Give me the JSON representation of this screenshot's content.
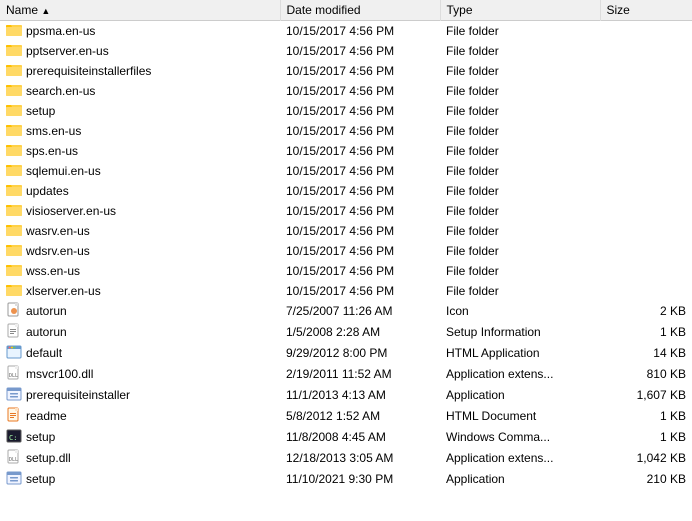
{
  "columns": [
    {
      "label": "Name",
      "key": "name",
      "sort": true
    },
    {
      "label": "Date modified",
      "key": "date"
    },
    {
      "label": "Type",
      "key": "type"
    },
    {
      "label": "Size",
      "key": "size"
    }
  ],
  "rows": [
    {
      "name": "ppsma.en-us",
      "date": "10/15/2017 4:56 PM",
      "type": "File folder",
      "size": "",
      "icon": "folder"
    },
    {
      "name": "pptserver.en-us",
      "date": "10/15/2017 4:56 PM",
      "type": "File folder",
      "size": "",
      "icon": "folder"
    },
    {
      "name": "prerequisiteinstallerfiles",
      "date": "10/15/2017 4:56 PM",
      "type": "File folder",
      "size": "",
      "icon": "folder"
    },
    {
      "name": "search.en-us",
      "date": "10/15/2017 4:56 PM",
      "type": "File folder",
      "size": "",
      "icon": "folder"
    },
    {
      "name": "setup",
      "date": "10/15/2017 4:56 PM",
      "type": "File folder",
      "size": "",
      "icon": "folder"
    },
    {
      "name": "sms.en-us",
      "date": "10/15/2017 4:56 PM",
      "type": "File folder",
      "size": "",
      "icon": "folder"
    },
    {
      "name": "sps.en-us",
      "date": "10/15/2017 4:56 PM",
      "type": "File folder",
      "size": "",
      "icon": "folder"
    },
    {
      "name": "sqlemui.en-us",
      "date": "10/15/2017 4:56 PM",
      "type": "File folder",
      "size": "",
      "icon": "folder"
    },
    {
      "name": "updates",
      "date": "10/15/2017 4:56 PM",
      "type": "File folder",
      "size": "",
      "icon": "folder"
    },
    {
      "name": "visioserver.en-us",
      "date": "10/15/2017 4:56 PM",
      "type": "File folder",
      "size": "",
      "icon": "folder"
    },
    {
      "name": "wasrv.en-us",
      "date": "10/15/2017 4:56 PM",
      "type": "File folder",
      "size": "",
      "icon": "folder"
    },
    {
      "name": "wdsrv.en-us",
      "date": "10/15/2017 4:56 PM",
      "type": "File folder",
      "size": "",
      "icon": "folder"
    },
    {
      "name": "wss.en-us",
      "date": "10/15/2017 4:56 PM",
      "type": "File folder",
      "size": "",
      "icon": "folder"
    },
    {
      "name": "xlserver.en-us",
      "date": "10/15/2017 4:56 PM",
      "type": "File folder",
      "size": "",
      "icon": "folder"
    },
    {
      "name": "autorun",
      "date": "7/25/2007 11:26 AM",
      "type": "Icon",
      "size": "2 KB",
      "icon": "icon-file"
    },
    {
      "name": "autorun",
      "date": "1/5/2008 2:28 AM",
      "type": "Setup Information",
      "size": "1 KB",
      "icon": "setup-inf"
    },
    {
      "name": "default",
      "date": "9/29/2012 8:00 PM",
      "type": "HTML Application",
      "size": "14 KB",
      "icon": "html-app"
    },
    {
      "name": "msvcr100.dll",
      "date": "2/19/2011 11:52 AM",
      "type": "Application extens...",
      "size": "810 KB",
      "icon": "dll-file"
    },
    {
      "name": "prerequisiteinstaller",
      "date": "11/1/2013 4:13 AM",
      "type": "Application",
      "size": "1,607 KB",
      "icon": "exe-file"
    },
    {
      "name": "readme",
      "date": "5/8/2012 1:52 AM",
      "type": "HTML Document",
      "size": "1 KB",
      "icon": "html-doc"
    },
    {
      "name": "setup",
      "date": "11/8/2008 4:45 AM",
      "type": "Windows Comma...",
      "size": "1 KB",
      "icon": "cmd-file"
    },
    {
      "name": "setup.dll",
      "date": "12/18/2013 3:05 AM",
      "type": "Application extens...",
      "size": "1,042 KB",
      "icon": "dll-file"
    },
    {
      "name": "setup",
      "date": "11/10/2021 9:30 PM",
      "type": "Application",
      "size": "210 KB",
      "icon": "exe-file"
    }
  ]
}
